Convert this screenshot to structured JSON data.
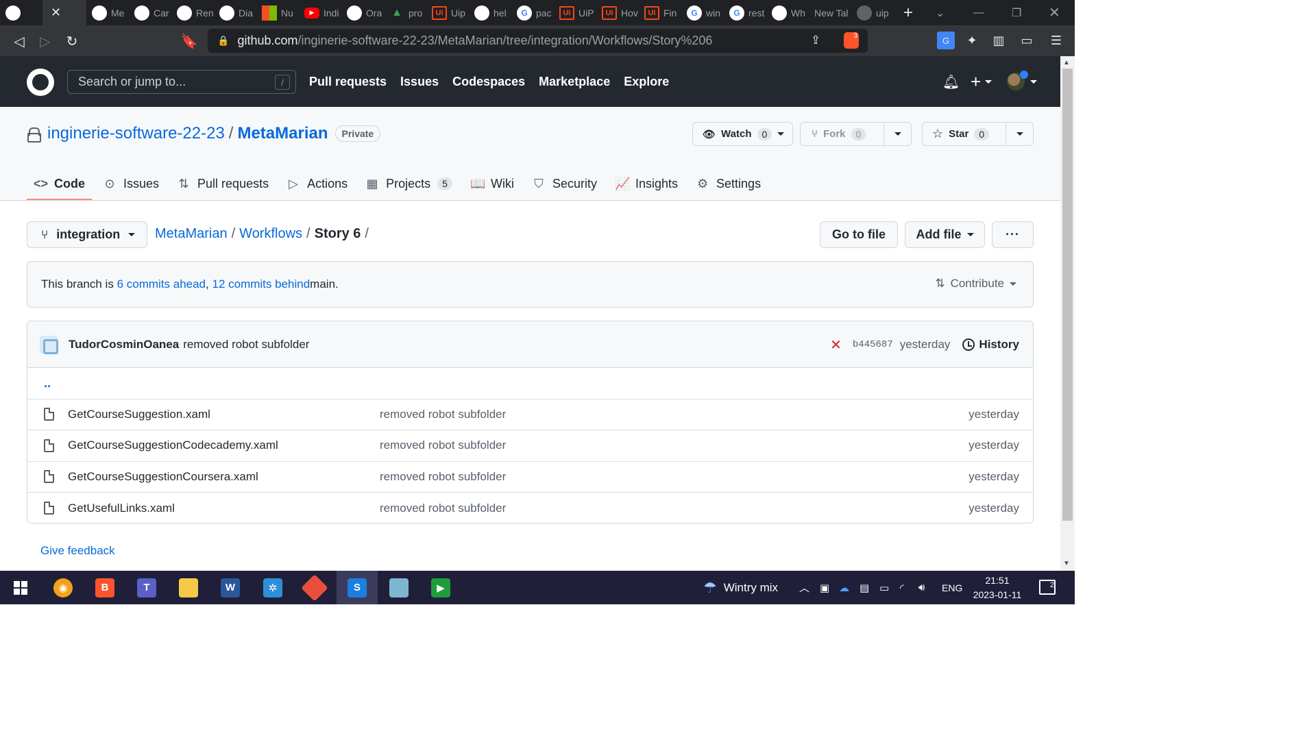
{
  "browser": {
    "tabs": [
      {
        "label": "",
        "icon": "github-icon",
        "kind": "gh"
      },
      {
        "label": "",
        "icon": "close-icon",
        "kind": "close",
        "active": true
      },
      {
        "label": "Me",
        "icon": "github-icon",
        "kind": "gh"
      },
      {
        "label": "Car",
        "icon": "github-icon",
        "kind": "gh"
      },
      {
        "label": "Ren",
        "icon": "github-icon",
        "kind": "gh"
      },
      {
        "label": "Dia",
        "icon": "github-icon",
        "kind": "gh"
      },
      {
        "label": "Nu",
        "icon": "microsoft-icon",
        "kind": "ms"
      },
      {
        "label": "Indi",
        "icon": "youtube-icon",
        "kind": "yt"
      },
      {
        "label": "Ora",
        "icon": "github-icon",
        "kind": "gh"
      },
      {
        "label": "pro",
        "icon": "drive-icon",
        "kind": "drive"
      },
      {
        "label": "Uip",
        "icon": "uipath-icon",
        "kind": "ui"
      },
      {
        "label": "hel",
        "icon": "github-icon",
        "kind": "gh"
      },
      {
        "label": "pac",
        "icon": "google-icon",
        "kind": "g"
      },
      {
        "label": "UiP",
        "icon": "uipath-icon",
        "kind": "ui"
      },
      {
        "label": "Hov",
        "icon": "uipath-icon",
        "kind": "ui"
      },
      {
        "label": "Fin",
        "icon": "uipath-icon",
        "kind": "ui"
      },
      {
        "label": "win",
        "icon": "google-icon",
        "kind": "g"
      },
      {
        "label": "rest",
        "icon": "google-icon",
        "kind": "g"
      },
      {
        "label": "Wh",
        "icon": "github-icon",
        "kind": "gh"
      },
      {
        "label": "New Tal",
        "icon": "",
        "kind": "none"
      },
      {
        "label": "uip",
        "icon": "globe-icon",
        "kind": "glob"
      }
    ],
    "url_host": "github.com",
    "url_path": "/inginerie-software-22-23/MetaMarian/tree/integration/Workflows/Story%206",
    "brave_badge": "3"
  },
  "github": {
    "search_placeholder": "Search or jump to...",
    "search_shortcut": "/",
    "nav": [
      "Pull requests",
      "Issues",
      "Codespaces",
      "Marketplace",
      "Explore"
    ]
  },
  "repo": {
    "owner": "inginerie-software-22-23",
    "separator": "/",
    "name": "MetaMarian",
    "visibility": "Private",
    "watch_label": "Watch",
    "watch_count": "0",
    "fork_label": "Fork",
    "fork_count": "0",
    "star_label": "Star",
    "star_count": "0",
    "tabs": [
      {
        "label": "Code",
        "icon": "code-icon",
        "glyph": "<>",
        "selected": true
      },
      {
        "label": "Issues",
        "icon": "issue-icon",
        "glyph": "⊙"
      },
      {
        "label": "Pull requests",
        "icon": "pull-request-icon",
        "glyph": "⇅"
      },
      {
        "label": "Actions",
        "icon": "play-icon",
        "glyph": "▷"
      },
      {
        "label": "Projects",
        "icon": "table-icon",
        "glyph": "▦",
        "count": "5"
      },
      {
        "label": "Wiki",
        "icon": "book-icon",
        "glyph": "📖"
      },
      {
        "label": "Security",
        "icon": "shield-icon",
        "glyph": "⛉"
      },
      {
        "label": "Insights",
        "icon": "graph-icon",
        "glyph": "📈"
      },
      {
        "label": "Settings",
        "icon": "gear-icon",
        "glyph": "⚙"
      }
    ]
  },
  "content": {
    "branch": "integration",
    "crumbs": {
      "root": "MetaMarian",
      "folder": "Workflows",
      "current": "Story 6",
      "sep": "/"
    },
    "go_to_file": "Go to file",
    "add_file": "Add file",
    "more": "···",
    "branch_info": {
      "prefix": "This branch is ",
      "ahead": "6 commits ahead",
      "comma": ", ",
      "behind": "12 commits behind",
      "suffix": " main."
    },
    "contribute": "Contribute",
    "commit": {
      "author": "TudorCosminOanea",
      "message": "removed robot subfolder",
      "status": "✕",
      "sha": "b445687",
      "time": "yesterday",
      "history": "History"
    },
    "parent_dir": "..",
    "files": [
      {
        "name": "GetCourseSuggestion.xaml",
        "message": "removed robot subfolder",
        "age": "yesterday"
      },
      {
        "name": "GetCourseSuggestionCodecademy.xaml",
        "message": "removed robot subfolder",
        "age": "yesterday"
      },
      {
        "name": "GetCourseSuggestionCoursera.xaml",
        "message": "removed robot subfolder",
        "age": "yesterday"
      },
      {
        "name": "GetUsefulLinks.xaml",
        "message": "removed robot subfolder",
        "age": "yesterday"
      }
    ],
    "feedback": "Give feedback"
  },
  "taskbar": {
    "weather": "Wintry mix",
    "language": "ENG",
    "time": "21:51",
    "date": "2023-01-11",
    "notifications": "2"
  }
}
